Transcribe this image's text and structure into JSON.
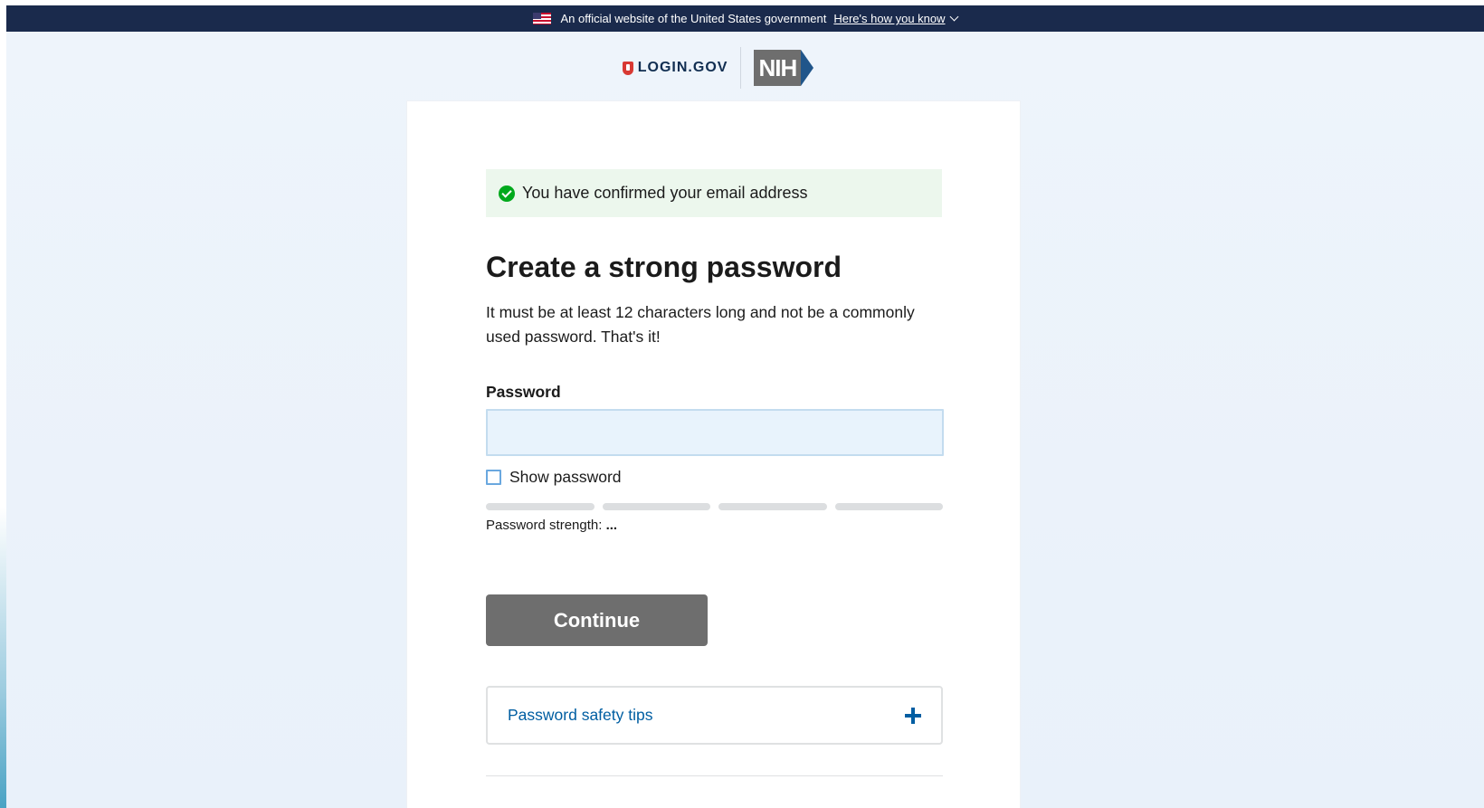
{
  "banner": {
    "text": "An official website of the United States government",
    "link": "Here's how you know"
  },
  "logos": {
    "login_gov": "LOGIN.GOV",
    "nih": "NIH"
  },
  "alert": {
    "text": "You have confirmed your email address"
  },
  "form": {
    "heading": "Create a strong password",
    "intro": "It must be at least 12 characters long and not be a commonly used password. That's it!",
    "password_label": "Password",
    "password_value": "",
    "show_password_label": "Show password",
    "strength_label": "Password strength:",
    "strength_value": "...",
    "continue_label": "Continue",
    "tips_label": "Password safety tips"
  },
  "colors": {
    "banner_bg": "#1a2a4c",
    "alert_bg": "#ecf7ed",
    "success": "#00a91c",
    "button_bg": "#6e6e6e",
    "link": "#005ea2"
  }
}
